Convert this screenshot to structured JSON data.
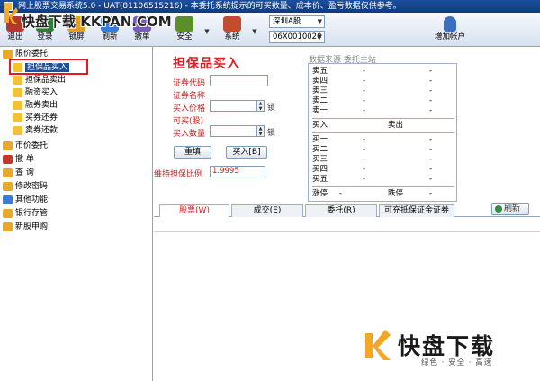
{
  "window": {
    "title": "网上股票交易系统5.0 - UAT(81106515216) - 本委托系统提示的可买数量、成本价、盈亏数据仅供参考。"
  },
  "watermark_top": {
    "text": "快盘下载 KKPAN.COM"
  },
  "toolbar": {
    "buttons": [
      {
        "label": "退出",
        "icon": "exit-icon",
        "color": "#b03a2e"
      },
      {
        "label": "登录",
        "icon": "login-icon",
        "color": "#2e7d32"
      },
      {
        "label": "锁屏",
        "icon": "lock-icon",
        "color": "#e0a020"
      },
      {
        "label": "刷新",
        "icon": "refresh-icon",
        "color": "#3a7bd5"
      },
      {
        "label": "撤单",
        "icon": "cancel-order-icon",
        "color": "#7a5bbf"
      },
      {
        "label": "安全",
        "icon": "security-icon",
        "color": "#5a8f29"
      },
      {
        "label": "系统",
        "icon": "system-icon",
        "color": "#c44b2b"
      }
    ],
    "market_select": "深圳A股",
    "account_select": "06X0010020",
    "add_account_label": "增加帐户"
  },
  "sidebar": {
    "items": [
      {
        "label": "限价委托",
        "icon": "folder-icon"
      },
      {
        "label": "担保品买入",
        "icon": "buy-icon"
      },
      {
        "label": "担保品卖出",
        "icon": "sell-icon"
      },
      {
        "label": "融资买入",
        "icon": "margin-buy-icon"
      },
      {
        "label": "融券卖出",
        "icon": "short-sell-icon"
      },
      {
        "label": "买券还券",
        "icon": "buy-return-icon"
      },
      {
        "label": "卖券还款",
        "icon": "sell-repay-icon"
      },
      {
        "label": "市价委托",
        "icon": "folder-icon"
      },
      {
        "label": "撤 单",
        "icon": "cancel-icon"
      },
      {
        "label": "查 询",
        "icon": "query-icon"
      },
      {
        "label": "修改密码",
        "icon": "password-icon"
      },
      {
        "label": "其他功能",
        "icon": "other-icon"
      },
      {
        "label": "银行存管",
        "icon": "bank-icon"
      },
      {
        "label": "新股申购",
        "icon": "ipo-icon"
      }
    ]
  },
  "form": {
    "title": "担保品买入",
    "code_label": "证券代码",
    "code_value": "",
    "name_label": "证券名称",
    "price_label": "买入价格",
    "price_value": "",
    "available_label": "可买(股)",
    "qty_label": "买入数量",
    "qty_value": "",
    "lock_label": "锁",
    "reset_label": "重填",
    "buy_label": "买入[B]",
    "ratio_label": "维持担保比例",
    "ratio_value": "1.9995"
  },
  "quote": {
    "header": "数据来源 委托主站",
    "sell_rows": [
      {
        "label": "卖五",
        "price": "-",
        "vol": "-"
      },
      {
        "label": "卖四",
        "price": "-",
        "vol": "-"
      },
      {
        "label": "卖三",
        "price": "-",
        "vol": "-"
      },
      {
        "label": "卖二",
        "price": "-",
        "vol": "-"
      },
      {
        "label": "卖一",
        "price": "-",
        "vol": "-"
      }
    ],
    "buy_label": "买入",
    "sell_label": "卖出",
    "buy_rows": [
      {
        "label": "买一",
        "price": "-",
        "vol": "-"
      },
      {
        "label": "买二",
        "price": "-",
        "vol": "-"
      },
      {
        "label": "买三",
        "price": "-",
        "vol": "-"
      },
      {
        "label": "买四",
        "price": "-",
        "vol": "-"
      },
      {
        "label": "买五",
        "price": "-",
        "vol": "-"
      }
    ],
    "limit_up_label": "涨停",
    "limit_up_value": "-",
    "limit_down_label": "跌停",
    "limit_down_value": "-"
  },
  "tabs": [
    {
      "label": "股票(W)"
    },
    {
      "label": "成交(E)"
    },
    {
      "label": "委托(R)"
    },
    {
      "label": "可充抵保证金证券"
    }
  ],
  "refresh_label": "刷新",
  "brand": {
    "name": "快盘下载",
    "tagline": "绿色 · 安全 · 高速",
    "accent": "#f5a623"
  }
}
